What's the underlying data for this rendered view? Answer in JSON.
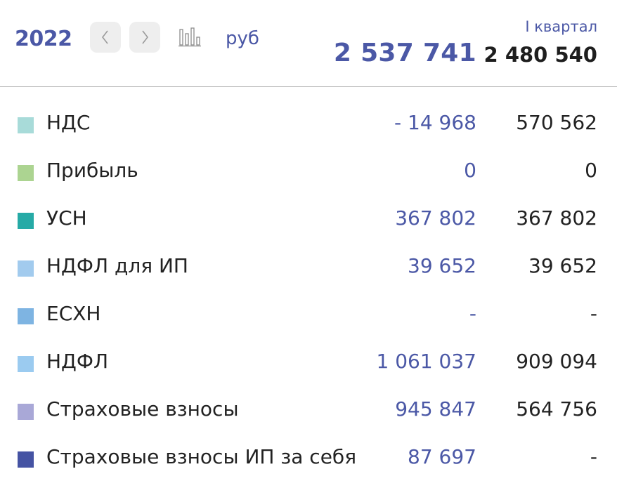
{
  "header": {
    "year": "2022",
    "currency": "руб",
    "period": "I квартал",
    "total_primary": "2 537 741",
    "total_secondary": "2 480 540"
  },
  "rows": [
    {
      "name": "НДС",
      "value_primary": "- 14 968",
      "value_secondary": "570 562",
      "color": "#a8dbd9"
    },
    {
      "name": "Прибыль",
      "value_primary": "0",
      "value_secondary": "0",
      "color": "#acd491"
    },
    {
      "name": "УСН",
      "value_primary": "367 802",
      "value_secondary": "367 802",
      "color": "#26aaa6"
    },
    {
      "name": "НДФЛ для ИП",
      "value_primary": "39 652",
      "value_secondary": "39 652",
      "color": "#a2cbee"
    },
    {
      "name": "ЕСХН",
      "value_primary": "-",
      "value_secondary": "-",
      "color": "#7eb4e2"
    },
    {
      "name": "НДФЛ",
      "value_primary": "1 061 037",
      "value_secondary": "909 094",
      "color": "#9bcbf0"
    },
    {
      "name": "Страховые взносы",
      "value_primary": "945 847",
      "value_secondary": "564 756",
      "color": "#a9a8d7"
    },
    {
      "name": "Страховые взносы ИП за себя",
      "value_primary": "87 697",
      "value_secondary": "-",
      "color": "#4553a3"
    }
  ]
}
